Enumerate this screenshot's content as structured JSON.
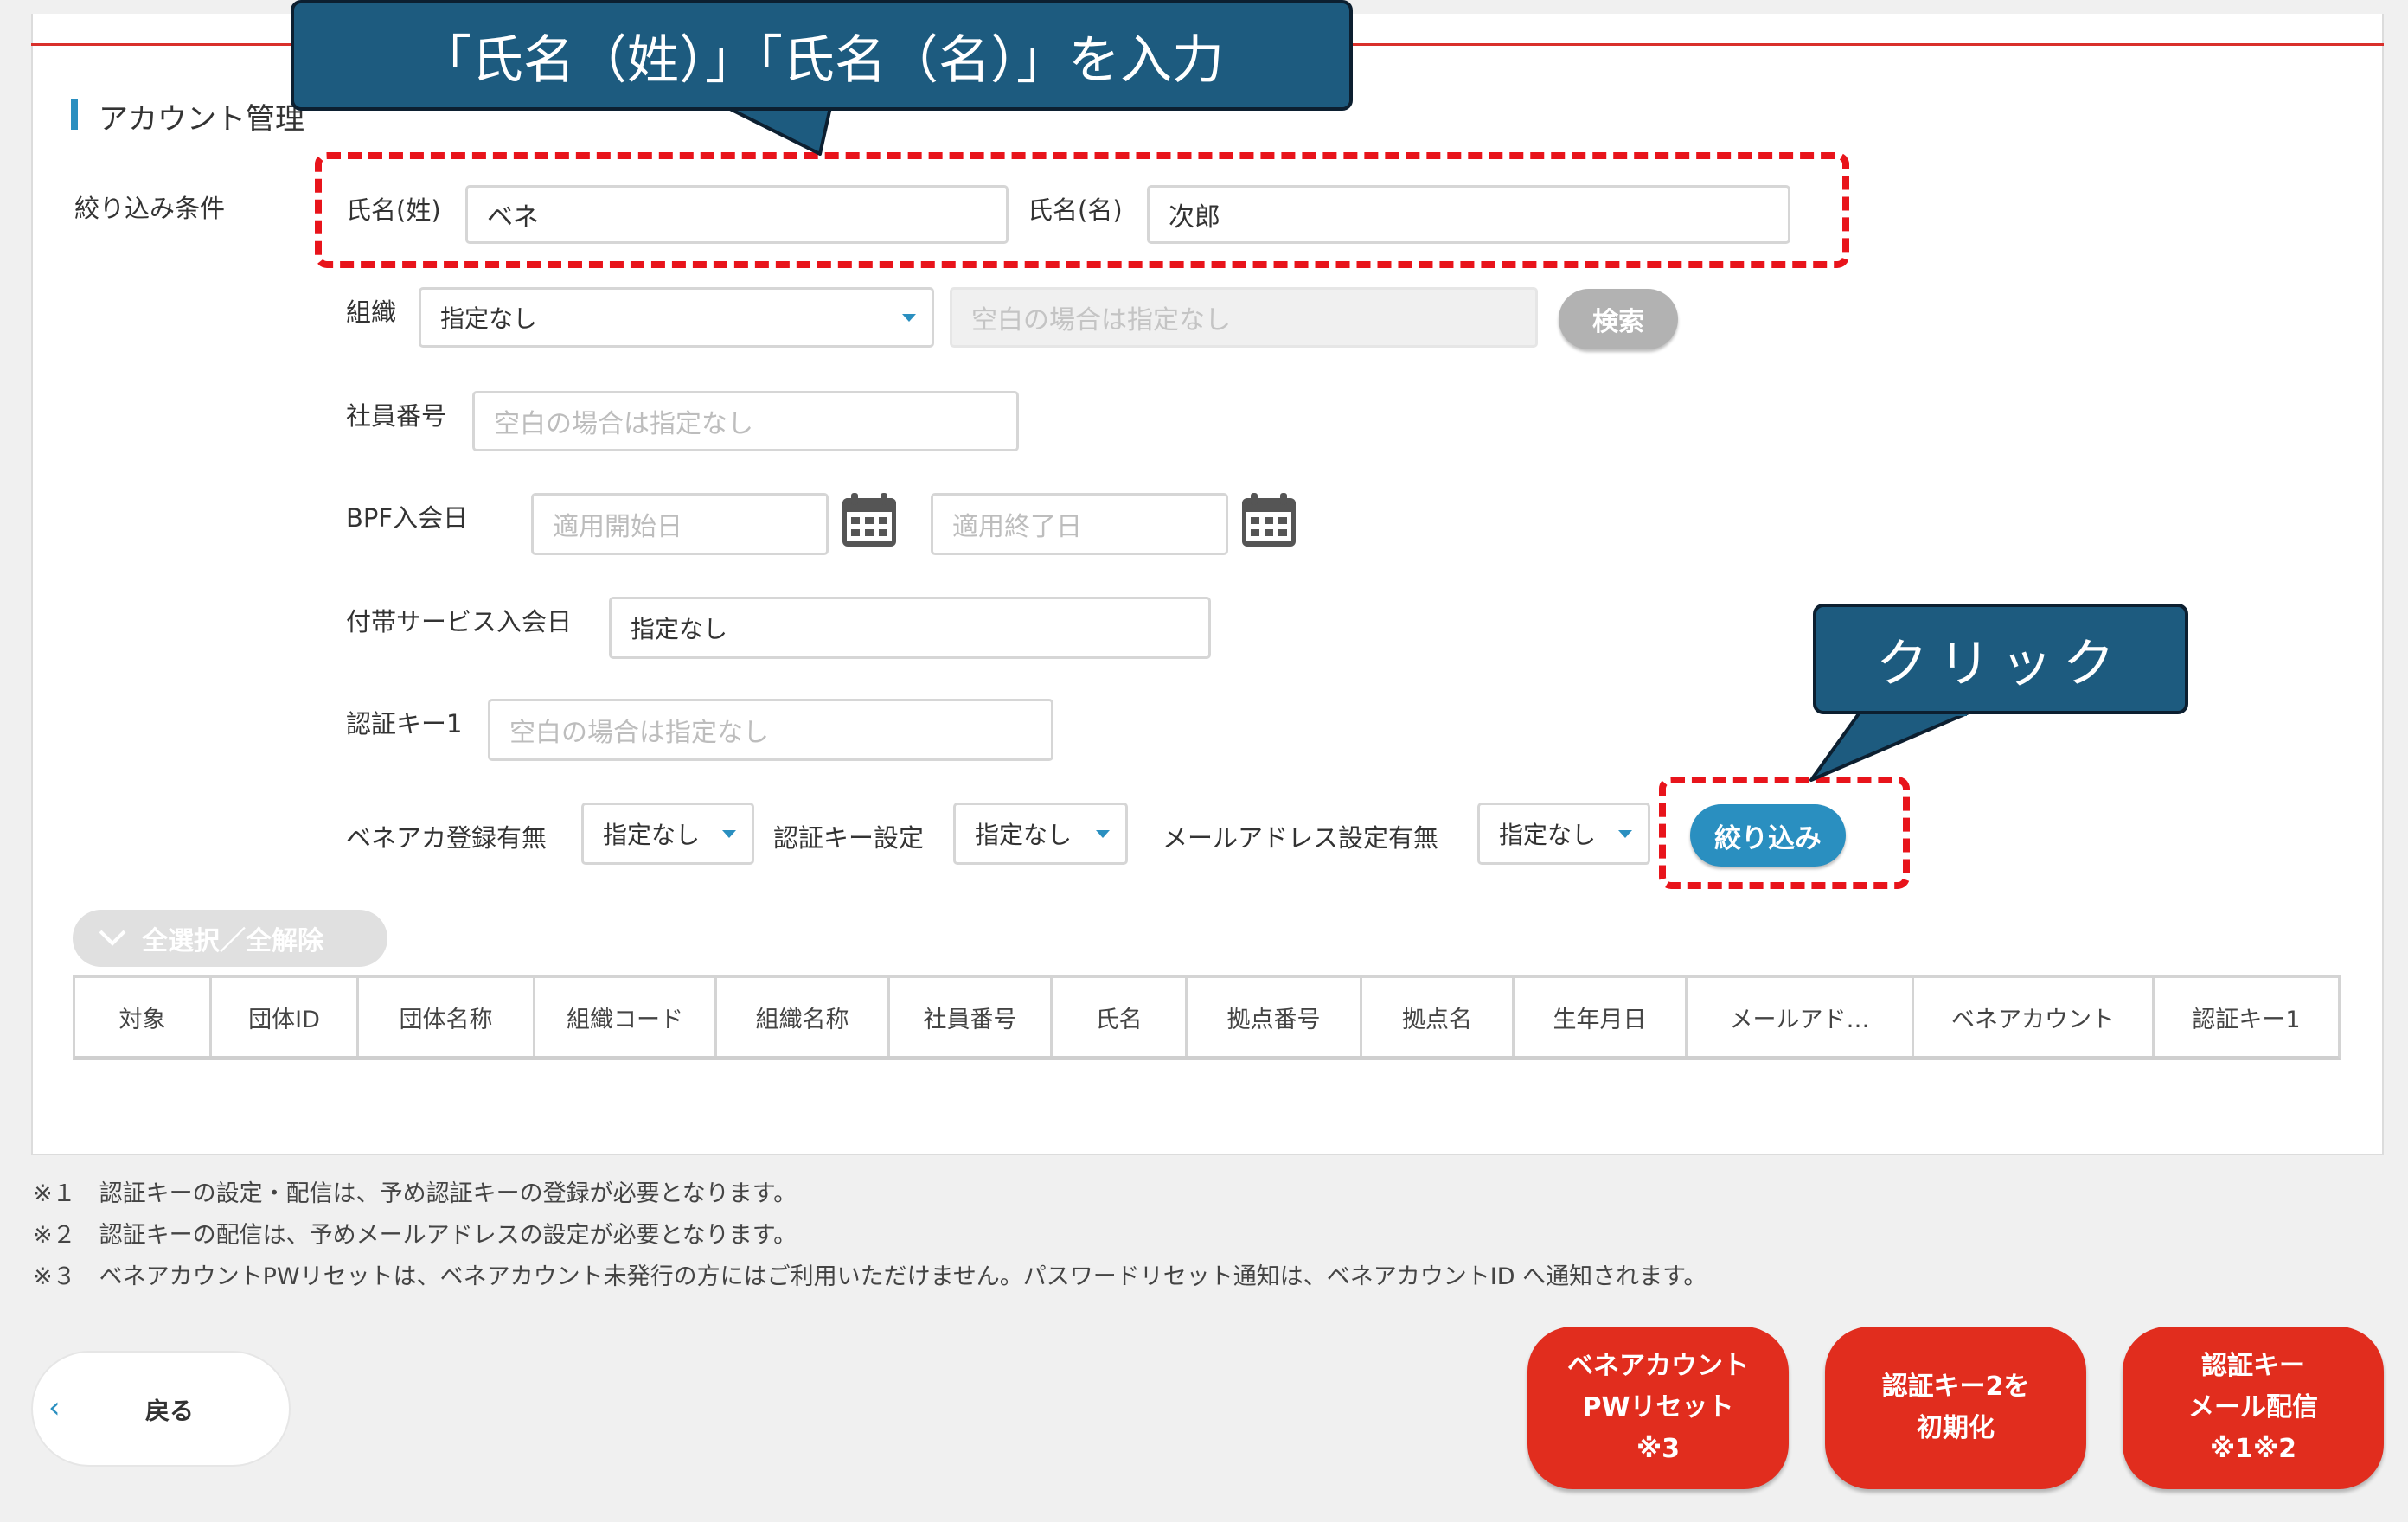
{
  "section": {
    "title": "アカウント管理"
  },
  "filter": {
    "conditions_label": "絞り込み条件",
    "last_name": {
      "label": "氏名(姓)",
      "value": "ベネ"
    },
    "first_name": {
      "label": "氏名(名)",
      "value": "次郎"
    },
    "organization": {
      "label": "組織",
      "selected": "指定なし",
      "text_placeholder": "空白の場合は指定なし",
      "search_button": "検索"
    },
    "employee_no": {
      "label": "社員番号",
      "placeholder": "空白の場合は指定なし"
    },
    "bpf_join": {
      "label": "BPF入会日",
      "start_placeholder": "適用開始日",
      "end_placeholder": "適用終了日"
    },
    "service_join": {
      "label": "付帯サービス入会日",
      "value": "指定なし"
    },
    "auth_key1": {
      "label": "認証キー1",
      "placeholder": "空白の場合は指定なし"
    },
    "benea_registered": {
      "label": "ベネアカ登録有無",
      "selected": "指定なし"
    },
    "auth_key_setting": {
      "label": "認証キー設定",
      "selected": "指定なし"
    },
    "email_setting": {
      "label": "メールアドレス設定有無",
      "selected": "指定なし"
    },
    "filter_button": "絞り込み"
  },
  "select_all_button": "全選択／全解除",
  "table": {
    "columns": [
      "対象",
      "団体ID",
      "団体名称",
      "組織コード",
      "組織名称",
      "社員番号",
      "氏名",
      "拠点番号",
      "拠点名",
      "生年月日",
      "メールアド…",
      "ベネアカウント",
      "認証キー1"
    ]
  },
  "notes": [
    "※１　認証キーの設定・配信は、予め認証キーの登録が必要となります。",
    "※２　認証キーの配信は、予めメールアドレスの設定が必要となります。",
    "※３　ベネアカウントPWリセットは、ベネアカウント未発行の方にはご利用いただけません。パスワードリセット通知は、ベネアカウントID へ通知されます。"
  ],
  "buttons": {
    "back": "戻る",
    "pw_reset": [
      "ベネアカウント",
      "PWリセット",
      "※3"
    ],
    "auth_key2_init": [
      "認証キー2を",
      "初期化"
    ],
    "auth_key_mail": [
      "認証キー",
      "メール配信",
      "※1※2"
    ]
  },
  "callouts": {
    "name_input": "「氏名（姓）」「氏名（名）」を入力",
    "click": "クリック"
  },
  "colors": {
    "accent": "#2a8fc0",
    "danger": "#e12d1e",
    "callout": "#1d5b7f",
    "highlight": "#e8141b"
  },
  "icons": [
    "calendar-icon",
    "chevron-down-icon",
    "chevron-left-icon",
    "check-icon"
  ]
}
